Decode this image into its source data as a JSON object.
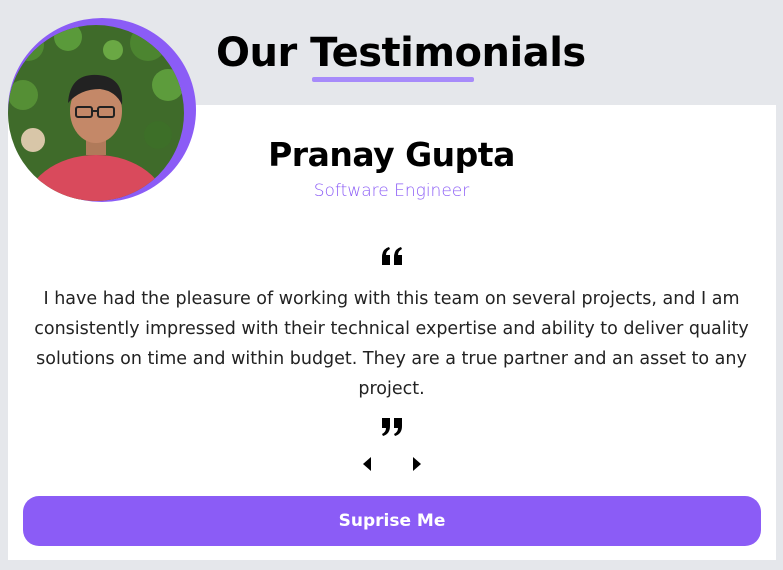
{
  "header": {
    "title": "Our Testimonials"
  },
  "testimonial": {
    "avatar_icon": "person-photo",
    "name": "Pranay Gupta",
    "role": "Software Engineer",
    "open_quote_icon": "quote-left-icon",
    "text": "I have had the pleasure of working with this team on several projects, and I am consistently impressed with their technical expertise and ability to deliver quality solutions on time and within budget. They are a true partner and an asset to any project.",
    "close_quote_icon": "quote-right-icon"
  },
  "controls": {
    "prev_icon": "caret-left-icon",
    "next_icon": "caret-right-icon",
    "surprise_label": "Suprise Me"
  },
  "colors": {
    "accent": "#8b5cf6",
    "underline": "#a78bfa",
    "background": "#e5e7eb",
    "card": "#ffffff"
  }
}
